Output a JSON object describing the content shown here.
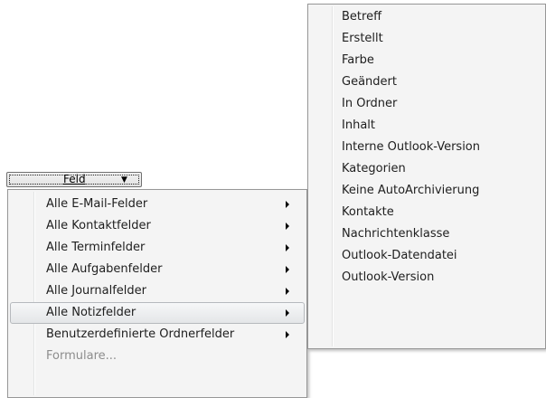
{
  "feld_dropdown": {
    "label": "Feld",
    "arrow": "▼"
  },
  "main_menu": {
    "items": [
      {
        "label": "Alle E-Mail-Felder",
        "has_submenu": true
      },
      {
        "label": "Alle Kontaktfelder",
        "has_submenu": true
      },
      {
        "label": "Alle Terminfelder",
        "has_submenu": true
      },
      {
        "label": "Alle Aufgabenfelder",
        "has_submenu": true
      },
      {
        "label": "Alle Journalfelder",
        "has_submenu": true
      },
      {
        "label": "Alle Notizfelder",
        "has_submenu": true,
        "highlighted": true
      },
      {
        "label": "Benutzerdefinierte Ordnerfelder",
        "has_submenu": true
      },
      {
        "label": "Formulare...",
        "has_submenu": false,
        "disabled": true
      }
    ]
  },
  "sub_menu": {
    "items": [
      {
        "label": "Betreff"
      },
      {
        "label": "Erstellt"
      },
      {
        "label": "Farbe"
      },
      {
        "label": "Geändert"
      },
      {
        "label": "In Ordner"
      },
      {
        "label": "Inhalt"
      },
      {
        "label": "Interne Outlook-Version"
      },
      {
        "label": "Kategorien"
      },
      {
        "label": "Keine AutoArchivierung"
      },
      {
        "label": "Kontakte"
      },
      {
        "label": "Nachrichtenklasse"
      },
      {
        "label": "Outlook-Datendatei"
      },
      {
        "label": "Outlook-Version"
      }
    ]
  },
  "colors": {
    "menu_background": "#f4f4f4",
    "menu_border": "#979797",
    "highlight_border": "#b6b9bd",
    "disabled_text": "#8d8d8d"
  }
}
